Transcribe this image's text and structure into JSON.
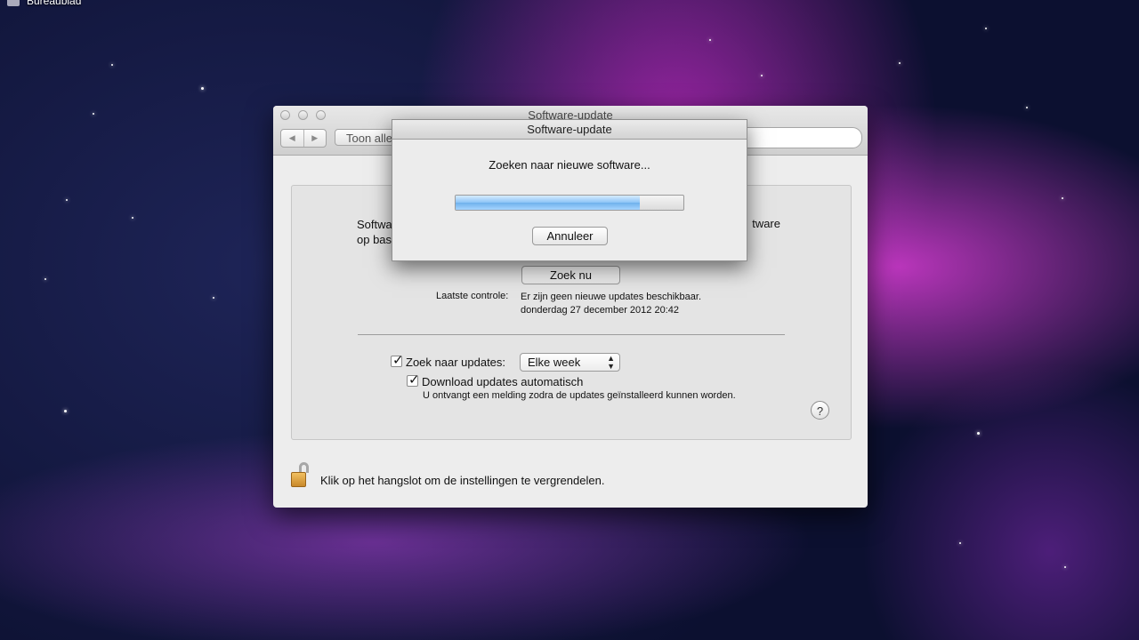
{
  "desktop": {
    "label": "Bureaublad"
  },
  "window": {
    "title": "Software-update",
    "nav_back": "◀",
    "nav_forward": "▶",
    "show_all": "Toon alle",
    "description_left": "Softwa",
    "description_left_line2": "op bas",
    "description_right": "tware",
    "check_now_label": "Zoek nu",
    "last_check_label": "Laatste controle:",
    "last_check_value": "Er zijn geen nieuwe updates beschikbaar.",
    "last_check_date": "donderdag 27 december 2012 20:42",
    "check_for_updates_label": "Zoek naar updates:",
    "check_for_updates_checked": true,
    "frequency_selected": "Elke week",
    "download_auto_label": "Download updates automatisch",
    "download_auto_checked": true,
    "download_note": "U ontvangt een melding zodra de updates geïnstalleerd kunnen worden.",
    "help_label": "?",
    "lock_text": "Klik op het hangslot om de instellingen te vergrendelen."
  },
  "sheet": {
    "title": "Software-update",
    "message": "Zoeken naar nieuwe software...",
    "progress": 0.81,
    "cancel_label": "Annuleer"
  }
}
